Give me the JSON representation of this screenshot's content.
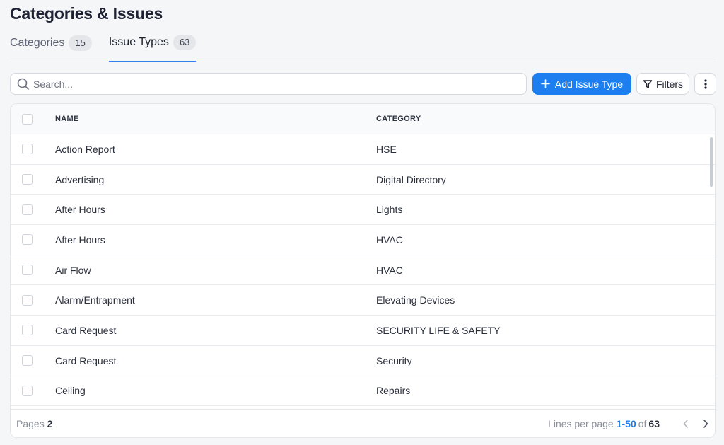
{
  "page": {
    "title": "Categories & Issues"
  },
  "tabs": [
    {
      "label": "Categories",
      "count": "15",
      "active": false
    },
    {
      "label": "Issue Types",
      "count": "63",
      "active": true
    }
  ],
  "toolbar": {
    "search_placeholder": "Search...",
    "add_label": "Add Issue Type",
    "filters_label": "Filters"
  },
  "table": {
    "columns": {
      "name": "NAME",
      "category": "CATEGORY"
    },
    "rows": [
      {
        "name": "Action Report",
        "category": "HSE"
      },
      {
        "name": "Advertising",
        "category": "Digital Directory"
      },
      {
        "name": "After Hours",
        "category": "Lights"
      },
      {
        "name": "After Hours",
        "category": "HVAC"
      },
      {
        "name": "Air Flow",
        "category": "HVAC"
      },
      {
        "name": "Alarm/Entrapment",
        "category": "Elevating Devices"
      },
      {
        "name": "Card Request",
        "category": "SECURITY LIFE & SAFETY"
      },
      {
        "name": "Card Request",
        "category": "Security"
      },
      {
        "name": "Ceiling",
        "category": "Repairs"
      }
    ]
  },
  "footer": {
    "pages_label": "Pages",
    "pages_value": "2",
    "lines_label": "Lines per page",
    "range": "1-50",
    "of_label": "of",
    "total": "63"
  },
  "colors": {
    "accent": "#1d7ef0",
    "tab_underline": "#2f80ed"
  }
}
